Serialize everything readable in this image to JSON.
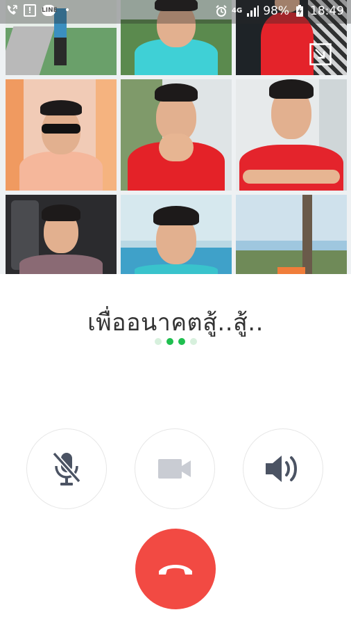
{
  "status_bar": {
    "battery": "98%",
    "time": "18:49",
    "network": "4G",
    "line_badge": "LINE"
  },
  "call": {
    "caller_name": "เพื่ออนาคตสู้..สู้..",
    "dots_active": 2
  },
  "controls": {
    "mute": "microphone-muted-icon",
    "video": "video-camera-icon",
    "speaker": "speaker-icon",
    "end": "end-call-icon"
  },
  "colors": {
    "accent_green": "#1fbf4f",
    "end_call_red": "#f24a43",
    "icon_gray": "#4b5363",
    "disabled_gray": "#c9ccd3"
  }
}
